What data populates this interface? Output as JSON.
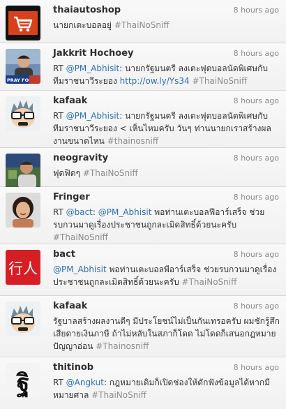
{
  "tweets": [
    {
      "user": "thaiautoshop",
      "time": "8 hours ago",
      "avatar": "shopping-cart-logo",
      "lines": [
        [
          {
            "t": "plain",
            "v": "นายกเตะบอลอยู่ "
          },
          {
            "t": "hashtag",
            "v": "#ThaiNoSniff"
          }
        ]
      ]
    },
    {
      "user": "Jakkrit Hochoey",
      "time": "8 hours ago",
      "avatar": "man-photo-pray-for",
      "avatar_text": "PRAY FOR",
      "lines": [
        [
          {
            "t": "plain",
            "v": "RT "
          },
          {
            "t": "mention",
            "v": "@PM_Abhisit"
          },
          {
            "t": "plain",
            "v": ": นายกรัฐมนตรี ลงเตะฟุตบอลนัดพิเศษกับ"
          }
        ],
        [
          {
            "t": "plain",
            "v": "ทีมราชนาวีระยอง "
          },
          {
            "t": "link",
            "v": "http://ow.ly/Ys34"
          },
          {
            "t": "plain",
            "v": " "
          },
          {
            "t": "hashtag",
            "v": "#ThaiNoSniff"
          }
        ]
      ]
    },
    {
      "user": "kafaak",
      "time": "8 hours ago",
      "avatar": "glasses-cartoon",
      "lines": [
        [
          {
            "t": "plain",
            "v": "RT "
          },
          {
            "t": "mention",
            "v": "@PM_Abhisit"
          },
          {
            "t": "plain",
            "v": ": นายกรัฐมนตรี ลงเตะฟุตบอลนัดพิเศษกับ"
          }
        ],
        [
          {
            "t": "plain",
            "v": "ทีมราชนาวีระยอง < เห็นไหมครับ วันๆ ท่านนายกเราสร้างผล"
          }
        ],
        [
          {
            "t": "plain",
            "v": "งานขนาดไหน "
          },
          {
            "t": "hashtag",
            "v": "#thainosniff"
          }
        ]
      ]
    },
    {
      "user": "neogravity",
      "time": "8 hours ago",
      "avatar": "person-photo",
      "lines": [
        [
          {
            "t": "plain",
            "v": "ฟุดฟิดๆ "
          },
          {
            "t": "hashtag",
            "v": "#ThaiNoSniff"
          }
        ]
      ]
    },
    {
      "user": "Fringer",
      "time": "8 hours ago",
      "avatar": "woman-photo",
      "lines": [
        [
          {
            "t": "plain",
            "v": "RT "
          },
          {
            "t": "mention",
            "v": "@bact"
          },
          {
            "t": "plain",
            "v": ": "
          },
          {
            "t": "mention",
            "v": "@PM_Abhisit"
          },
          {
            "t": "plain",
            "v": " พอท่านเตะบอลฟีอาร์เสร็จ ช่วย"
          }
        ],
        [
          {
            "t": "plain",
            "v": "รบกวนมาดูเรื่องประชาชนถูกละเมิดสิทธิ์ด้วยนะครับ"
          }
        ],
        [
          {
            "t": "hashtag",
            "v": "#ThaiNoSniff"
          }
        ]
      ]
    },
    {
      "user": "bact",
      "time": "8 hours ago",
      "avatar": "red-kanji-logo",
      "avatar_text": "行人",
      "lines": [
        [
          {
            "t": "mention",
            "v": "@PM_Abhisit"
          },
          {
            "t": "plain",
            "v": " พอท่านเตะบอลพีอาร์เสร็จ ช่วยรบกวนมาดูเรื่อง"
          }
        ],
        [
          {
            "t": "plain",
            "v": "ประชาชนถูกละเมิดสิทธิ์ด้วยนะครับ "
          },
          {
            "t": "hashtag",
            "v": "#ThaiNoSniff"
          }
        ]
      ]
    },
    {
      "user": "kafaak",
      "time": "8 hours ago",
      "avatar": "glasses-cartoon",
      "lines": [
        [
          {
            "t": "plain",
            "v": "รัฐบาลสร้างผลงานดีๆ มีประโยชน์ไม่เป็นกันเทรอครับ ผมชักรู้สึก"
          }
        ],
        [
          {
            "t": "plain",
            "v": "เสียดายเงินภาษี ถ้าไม่หลับในสภาก็โดด ไม่โดดก็เสนอกฎหมาย"
          }
        ],
        [
          {
            "t": "plain",
            "v": "ปัญญาอ่อน "
          },
          {
            "t": "hashtag",
            "v": "#Thainosniff"
          }
        ]
      ]
    },
    {
      "user": "thitinob",
      "time": "8 hours ago",
      "avatar": "thai-letter-logo",
      "avatar_text": "ฐิ",
      "lines": [
        [
          {
            "t": "plain",
            "v": "RT "
          },
          {
            "t": "mention",
            "v": "@Angkut"
          },
          {
            "t": "plain",
            "v": ": กฎหมายเดิมก็เปิดช่องให้ดักฟังข้อมูลได้หากมี"
          }
        ],
        [
          {
            "t": "plain",
            "v": "หมายศาล "
          },
          {
            "t": "hashtag",
            "v": "#ThaiNoSniff"
          }
        ]
      ]
    }
  ]
}
